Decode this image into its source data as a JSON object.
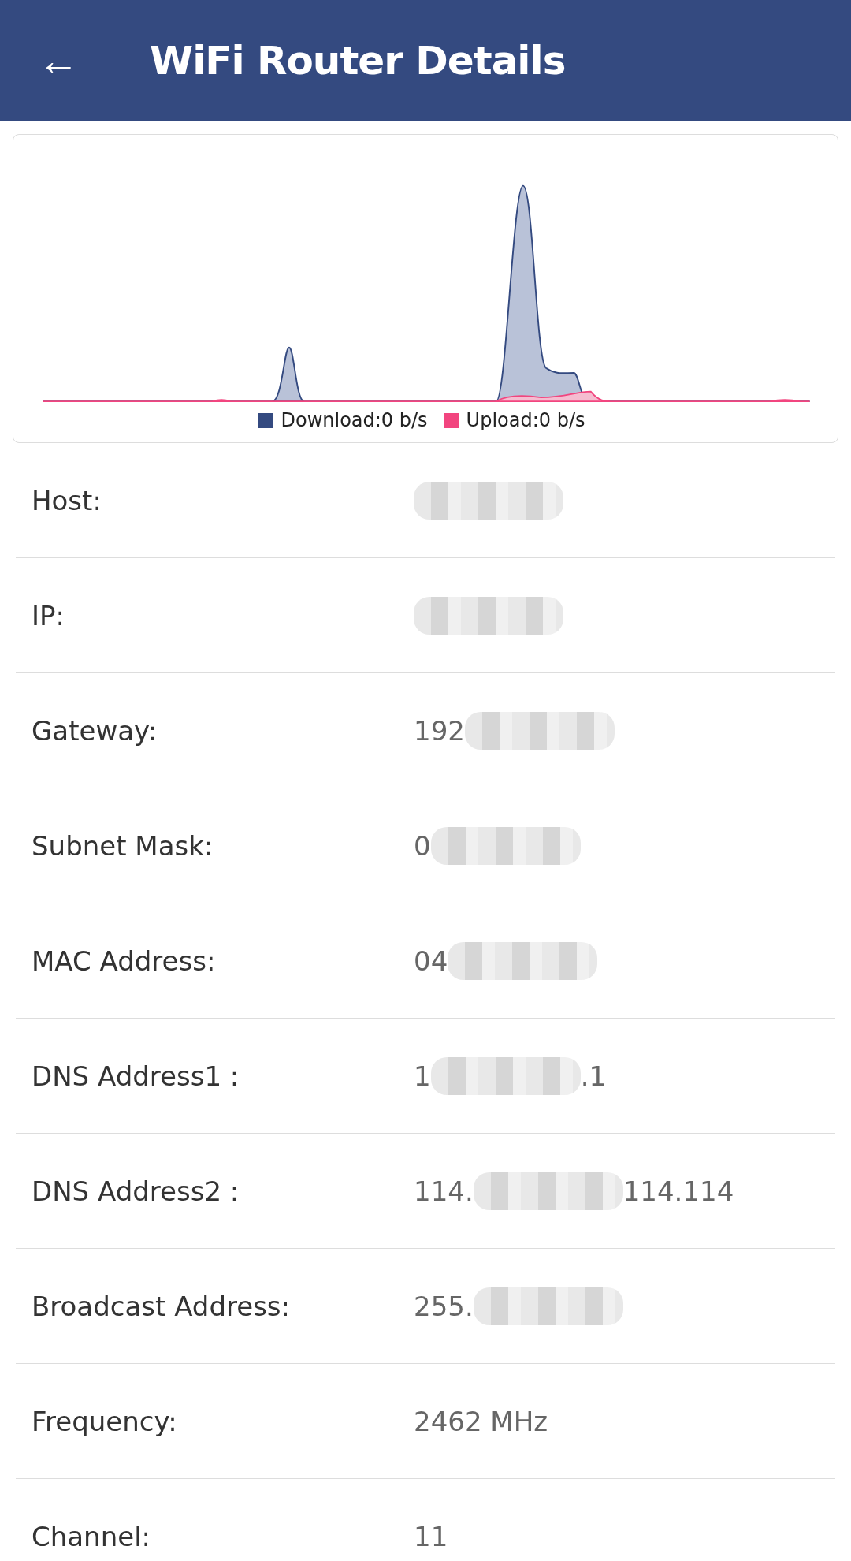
{
  "app_bar": {
    "back_icon": "←",
    "title": "WiFi Router Details"
  },
  "traffic_card": {
    "legend": [
      {
        "label": "Download:0 b/s",
        "color": "#344a80"
      },
      {
        "label": "Upload:0 b/s",
        "color": "#f2457f"
      }
    ]
  },
  "details": [
    {
      "label": "Host:",
      "value": [
        {
          "kind": "redacted"
        }
      ]
    },
    {
      "label": "IP:",
      "value": [
        {
          "kind": "redacted"
        }
      ]
    },
    {
      "label": "Gateway:",
      "value": [
        {
          "kind": "text",
          "text": "192"
        },
        {
          "kind": "redacted"
        }
      ]
    },
    {
      "label": "Subnet Mask:",
      "value": [
        {
          "kind": "text",
          "text": "0"
        },
        {
          "kind": "redacted"
        }
      ]
    },
    {
      "label": "MAC Address:",
      "value": [
        {
          "kind": "text",
          "text": "04"
        },
        {
          "kind": "redacted"
        }
      ]
    },
    {
      "label": "DNS Address1 :",
      "value": [
        {
          "kind": "text",
          "text": "1"
        },
        {
          "kind": "redacted"
        },
        {
          "kind": "text",
          "text": ".1"
        }
      ]
    },
    {
      "label": "DNS Address2 :",
      "value": [
        {
          "kind": "text",
          "text": "114."
        },
        {
          "kind": "redacted"
        },
        {
          "kind": "text",
          "text": "114.114"
        }
      ]
    },
    {
      "label": "Broadcast Address:",
      "value": [
        {
          "kind": "text",
          "text": "255."
        },
        {
          "kind": "redacted"
        }
      ]
    },
    {
      "label": "Frequency:",
      "value": [
        {
          "kind": "text",
          "text": "2462 MHz"
        }
      ]
    },
    {
      "label": "Channel:",
      "value": [
        {
          "kind": "text",
          "text": "11"
        }
      ]
    }
  ]
}
